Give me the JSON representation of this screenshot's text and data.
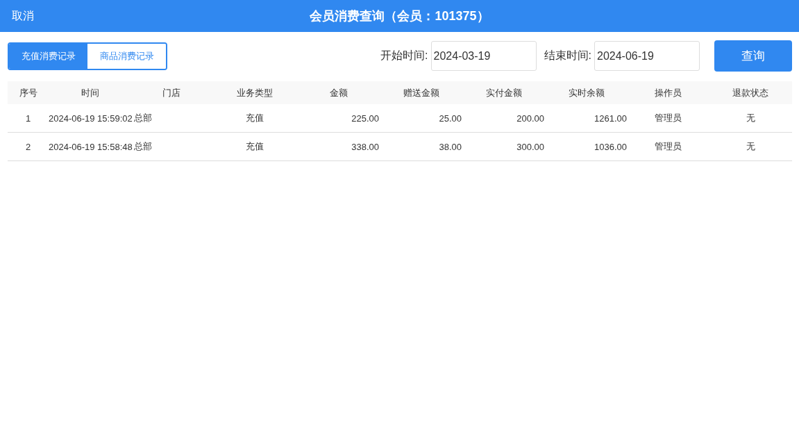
{
  "header": {
    "cancel": "取消",
    "title": "会员消费查询（会员：101375）"
  },
  "tabs": [
    {
      "label": "充值消费记录",
      "selected": true
    },
    {
      "label": "商品消费记录",
      "selected": false
    }
  ],
  "filters": {
    "start_label": "开始时间:",
    "start_value": "2024-03-19",
    "end_label": "结束时间:",
    "end_value": "2024-06-19",
    "query_button": "查询"
  },
  "table": {
    "columns": [
      "序号",
      "时间",
      "门店",
      "业务类型",
      "金额",
      "赠送金额",
      "实付金额",
      "实时余额",
      "操作员",
      "退款状态"
    ],
    "rows": [
      [
        "1",
        "2024-06-19 15:59:02",
        "总部",
        "充值",
        "225.00",
        "25.00",
        "200.00",
        "1261.00",
        "管理员",
        "无"
      ],
      [
        "2",
        "2024-06-19 15:58:48",
        "总部",
        "充值",
        "338.00",
        "38.00",
        "300.00",
        "1036.00",
        "管理员",
        "无"
      ]
    ]
  }
}
